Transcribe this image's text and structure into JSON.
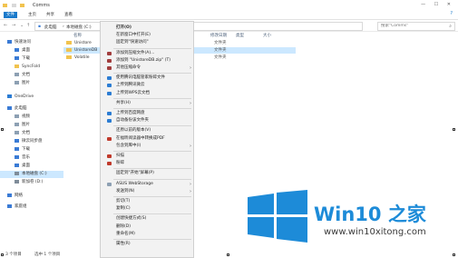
{
  "window": {
    "title": "Comms",
    "controls": "— ☐ ✕"
  },
  "ribbon": {
    "tabs": [
      "文件",
      "主页",
      "共享",
      "查看"
    ],
    "help": "?"
  },
  "address": {
    "crumbs": [
      "此电脑",
      "本地磁盘 (C:)",
      "Comms"
    ],
    "search_placeholder": "搜索\"Comms\""
  },
  "columns": {
    "name": "名称",
    "date": "修改日期",
    "type": "类型",
    "size": "大小"
  },
  "files": [
    {
      "name": "Unistore",
      "date": "",
      "type": "文件夹",
      "selected": false
    },
    {
      "name": "UnistoreDB",
      "date": "",
      "type": "文件夹",
      "selected": true
    },
    {
      "name": "Volatile",
      "date": "",
      "type": "文件夹",
      "selected": false
    }
  ],
  "nav": [
    {
      "label": "快速访问",
      "icon": "star-icon",
      "color": "#3a7bd5"
    },
    {
      "label": "桌面",
      "icon": "desktop-icon",
      "color": "#3a7bd5"
    },
    {
      "label": "下载",
      "icon": "download-icon",
      "color": "#3a7bd5"
    },
    {
      "label": "SyncFold",
      "icon": "folder-icon",
      "color": "#f1c34f"
    },
    {
      "label": "文档",
      "icon": "document-icon",
      "color": "#8da0b3"
    },
    {
      "label": "图片",
      "icon": "picture-icon",
      "color": "#8da0b3"
    },
    {
      "label": "OneDrive",
      "icon": "cloud-icon",
      "color": "#2b7cd3"
    },
    {
      "label": "此电脑",
      "icon": "computer-icon",
      "color": "#3a7bd5"
    },
    {
      "label": "视频",
      "icon": "video-icon",
      "color": "#8da0b3"
    },
    {
      "label": "图片",
      "icon": "picture-icon",
      "color": "#8da0b3"
    },
    {
      "label": "文档",
      "icon": "document-icon",
      "color": "#8da0b3"
    },
    {
      "label": "微云同步盘",
      "icon": "cloud-icon",
      "color": "#3a7bd5"
    },
    {
      "label": "下载",
      "icon": "download-icon",
      "color": "#3a7bd5"
    },
    {
      "label": "音乐",
      "icon": "music-icon",
      "color": "#3a7bd5"
    },
    {
      "label": "桌面",
      "icon": "desktop-icon",
      "color": "#3a7bd5"
    },
    {
      "label": "本地磁盘 (C:)",
      "icon": "drive-icon",
      "color": "#7f8c99"
    },
    {
      "label": "新加卷 (D:)",
      "icon": "drive-icon",
      "color": "#7f8c99"
    },
    {
      "label": "网络",
      "icon": "network-icon",
      "color": "#3a7bd5"
    },
    {
      "label": "家庭组",
      "icon": "homegroup-icon",
      "color": "#3a7bd5"
    }
  ],
  "menu": {
    "items": [
      {
        "label": "打开(O)",
        "bold": true,
        "icon": "",
        "arrow": false
      },
      {
        "label": "在新窗口中打开(E)",
        "icon": "",
        "arrow": false
      },
      {
        "label": "固定到\"快速访问\"",
        "icon": "",
        "arrow": false
      },
      {
        "sep": true
      },
      {
        "label": "添加到压缩文件(A)...",
        "icon": "archive-icon",
        "color": "#a23d3d",
        "arrow": false
      },
      {
        "label": "添加到 \"UnistoreDB.zip\" (T)",
        "icon": "archive-icon",
        "color": "#a23d3d",
        "arrow": false
      },
      {
        "label": "其他压缩命令",
        "icon": "archive-icon",
        "color": "#a23d3d",
        "arrow": true
      },
      {
        "sep": true
      },
      {
        "label": "使用腾讯电脑管家粉碎文件",
        "icon": "shield-icon",
        "color": "#2b7cd3",
        "arrow": false
      },
      {
        "label": "上传到腾讯微云",
        "icon": "cloud-upload-icon",
        "color": "#2b7cd3",
        "arrow": false
      },
      {
        "label": "上传到WPS云文档",
        "icon": "wps-icon",
        "color": "#2b7cd3",
        "arrow": false
      },
      {
        "sep": true
      },
      {
        "label": "共享(H)",
        "icon": "",
        "arrow": true
      },
      {
        "sep": true
      },
      {
        "label": "上传到百度网盘",
        "icon": "baidu-icon",
        "color": "#2b7cd3",
        "arrow": false
      },
      {
        "label": "自动备份该文件夹",
        "icon": "backup-icon",
        "color": "#2b7cd3",
        "arrow": false
      },
      {
        "sep": true
      },
      {
        "label": "还原以前的版本(V)",
        "icon": "",
        "arrow": false
      },
      {
        "label": "在福昕阅读器中转换成PDF",
        "icon": "pdf-icon",
        "color": "#c0392b",
        "arrow": false
      },
      {
        "label": "包含到库中(I)",
        "icon": "",
        "arrow": true
      },
      {
        "sep": true
      },
      {
        "label": "扫描",
        "icon": "scan-icon",
        "color": "#c0392b",
        "arrow": false
      },
      {
        "label": "粉碎",
        "icon": "shred-icon",
        "color": "#c0392b",
        "arrow": false
      },
      {
        "sep": true
      },
      {
        "label": "固定到\"开始\"屏幕(P)",
        "icon": "",
        "arrow": false
      },
      {
        "sep": true
      },
      {
        "label": "ASUS WebStorage",
        "icon": "asus-icon",
        "color": "#8da0b3",
        "arrow": true
      },
      {
        "label": "发送到(N)",
        "icon": "",
        "arrow": true
      },
      {
        "sep": true
      },
      {
        "label": "剪切(T)",
        "icon": "",
        "arrow": false
      },
      {
        "label": "复制(C)",
        "icon": "",
        "arrow": false
      },
      {
        "sep": true
      },
      {
        "label": "创建快捷方式(S)",
        "icon": "",
        "arrow": false
      },
      {
        "label": "删除(D)",
        "icon": "",
        "arrow": false
      },
      {
        "label": "重命名(M)",
        "icon": "",
        "arrow": false
      },
      {
        "sep": true
      },
      {
        "label": "属性(R)",
        "icon": "",
        "arrow": false
      }
    ]
  },
  "status": {
    "count": "3 个项目",
    "selected": "选中 1 个项目"
  },
  "watermark": {
    "title": "Win10 之家",
    "url": "www.win10xitong.com",
    "logo_color": "#1d8bd8"
  }
}
